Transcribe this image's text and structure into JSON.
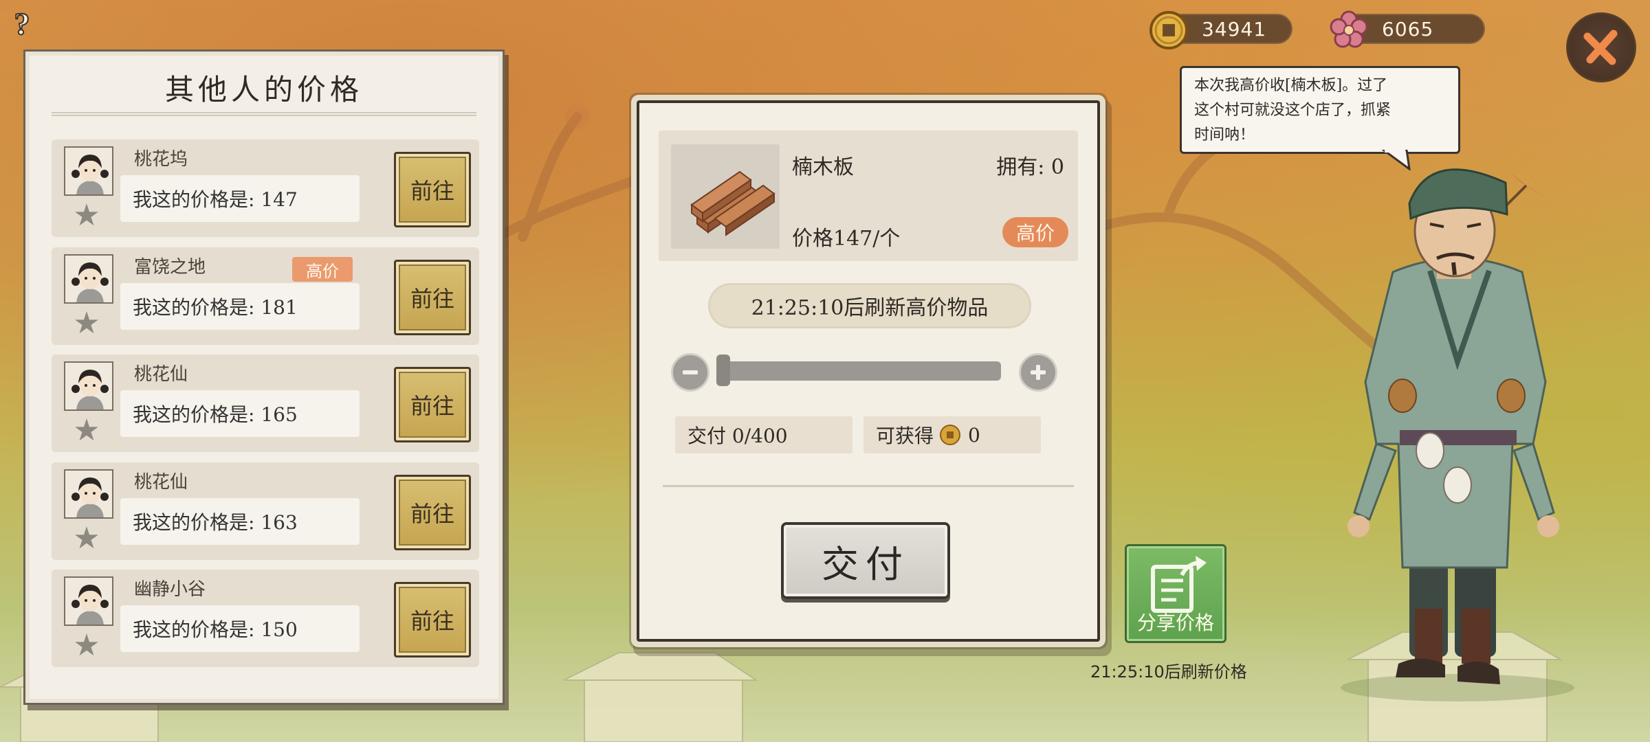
{
  "currency": {
    "coins": "34941",
    "flowers": "6065"
  },
  "left_panel": {
    "title": "其他人的价格",
    "rows": [
      {
        "name": "桃花坞",
        "price_text": "我这的价格是: 147",
        "high": false,
        "go_label": "前往"
      },
      {
        "name": "富饶之地",
        "price_text": "我这的价格是: 181",
        "high": true,
        "high_label": "高价",
        "go_label": "前往"
      },
      {
        "name": "桃花仙",
        "price_text": "我这的价格是: 165",
        "high": false,
        "go_label": "前往"
      },
      {
        "name": "桃花仙",
        "price_text": "我这的价格是: 163",
        "high": false,
        "go_label": "前往"
      },
      {
        "name": "幽静小谷",
        "price_text": "我这的价格是: 150",
        "high": false,
        "go_label": "前往"
      }
    ]
  },
  "item": {
    "name": "楠木板",
    "owned": "拥有: 0",
    "price": "价格147/个",
    "high_label": "高价"
  },
  "refresh_high": "21:25:10后刷新高价物品",
  "slider": {
    "value": 0,
    "max": 400
  },
  "deliver_stat": "交付 0/400",
  "gain_label": "可获得",
  "gain_value": "0",
  "deliver_button": "交付",
  "bubble": {
    "lines": [
      "本次我高价收[楠木板]。过了",
      "这个村可就没这个店了，抓紧",
      "时间呐！"
    ]
  },
  "share_label": "分享价格",
  "refresh_price": "21:25:10后刷新价格",
  "colors": {
    "high_tag": "#ea9a6c",
    "share_green": "#6aae58",
    "go_gold": "#c9a955"
  }
}
